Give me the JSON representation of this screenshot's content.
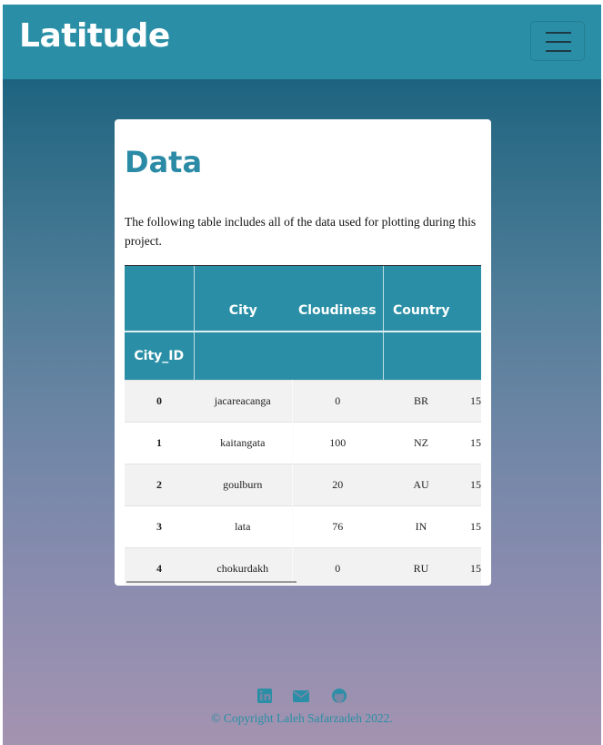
{
  "navbar": {
    "brand": "Latitude"
  },
  "card": {
    "title": "Data",
    "description": "The following table includes all of the data used for plotting during this project."
  },
  "table": {
    "header_row1": [
      "",
      "City",
      "Cloudiness",
      "Country",
      ""
    ],
    "header_row2": [
      "City_ID",
      "",
      "",
      "",
      ""
    ],
    "rows": [
      {
        "id": "0",
        "city": "jacareacanga",
        "cloudiness": "0",
        "country": "BR",
        "date": "15"
      },
      {
        "id": "1",
        "city": "kaitangata",
        "cloudiness": "100",
        "country": "NZ",
        "date": "15"
      },
      {
        "id": "2",
        "city": "goulburn",
        "cloudiness": "20",
        "country": "AU",
        "date": "15"
      },
      {
        "id": "3",
        "city": "lata",
        "cloudiness": "76",
        "country": "IN",
        "date": "15"
      },
      {
        "id": "4",
        "city": "chokurdakh",
        "cloudiness": "0",
        "country": "RU",
        "date": "15"
      }
    ]
  },
  "footer": {
    "icons": [
      "linkedin-icon",
      "envelope-icon",
      "github-icon"
    ],
    "copyright": "© Copyright Laleh Safarzadeh 2022."
  },
  "colors": {
    "accent": "#2a8fa6",
    "title": "#2b8ba6"
  }
}
